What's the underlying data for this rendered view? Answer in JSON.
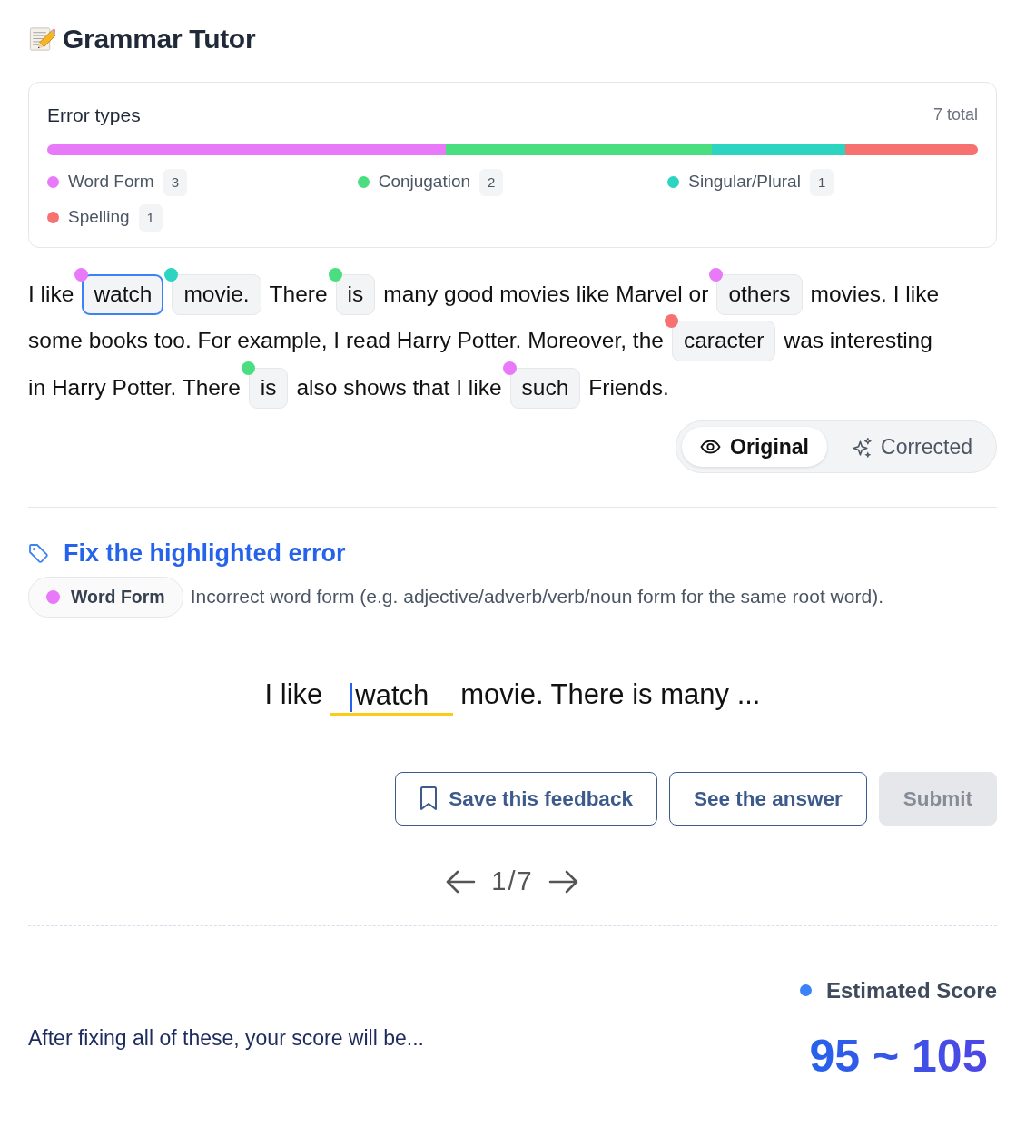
{
  "app": {
    "title": "Grammar Tutor"
  },
  "error_types": {
    "title": "Error types",
    "total": "7 total",
    "categories": [
      {
        "label": "Word Form",
        "count": "3",
        "color": "#e879f9"
      },
      {
        "label": "Conjugation",
        "count": "2",
        "color": "#4ade80"
      },
      {
        "label": "Singular/Plural",
        "count": "1",
        "color": "#2dd4bf"
      },
      {
        "label": "Spelling",
        "count": "1",
        "color": "#f87171"
      }
    ]
  },
  "passage": {
    "lines": [
      {
        "segments": [
          {
            "kind": "text",
            "text": "I like"
          },
          {
            "kind": "error",
            "text": "watch",
            "color": "#e879f9",
            "selected": true
          },
          {
            "kind": "error",
            "text": "movie.",
            "color": "#2dd4bf",
            "selected": false
          },
          {
            "kind": "text",
            "text": "There"
          },
          {
            "kind": "error",
            "text": "is",
            "color": "#4ade80",
            "selected": false
          },
          {
            "kind": "text",
            "text": "many good movies like Marvel or"
          },
          {
            "kind": "error",
            "text": "others",
            "color": "#e879f9",
            "selected": false
          },
          {
            "kind": "text",
            "text": "movies. I like"
          }
        ]
      },
      {
        "segments": [
          {
            "kind": "text",
            "text": "some books too. For example, I read Harry Potter. Moreover, the"
          },
          {
            "kind": "error",
            "text": "caracter",
            "color": "#f87171",
            "selected": false
          },
          {
            "kind": "text",
            "text": "was interesting"
          }
        ]
      },
      {
        "segments": [
          {
            "kind": "text",
            "text": "in Harry Potter. There"
          },
          {
            "kind": "error",
            "text": "is",
            "color": "#4ade80",
            "selected": false
          },
          {
            "kind": "text",
            "text": "also shows that I like"
          },
          {
            "kind": "error",
            "text": "such",
            "color": "#e879f9",
            "selected": false
          },
          {
            "kind": "text",
            "text": "Friends."
          }
        ]
      }
    ]
  },
  "view_toggle": [
    {
      "label": "Original",
      "selected": true
    },
    {
      "label": "Corrected",
      "selected": false
    }
  ],
  "error_detail": {
    "heading": "Fix the highlighted error",
    "category": {
      "label": "Word Form",
      "color": "#e879f9"
    },
    "description": "Incorrect word form (e.g. adjective/adverb/verb/noun form for the same root word)."
  },
  "exercise": {
    "before": "I like",
    "answer": {
      "value": "watch"
    },
    "after": "movie. There is many ..."
  },
  "buttons": [
    {
      "label": "Save this feedback",
      "disabled": false
    },
    {
      "label": "See the answer",
      "disabled": false
    },
    {
      "label": "Submit",
      "disabled": true
    }
  ],
  "pager": {
    "position": "1/7"
  },
  "score": {
    "message": "After fixing all of these, your score will be...",
    "label": "Estimated Score",
    "range": "95 ~ 105"
  }
}
